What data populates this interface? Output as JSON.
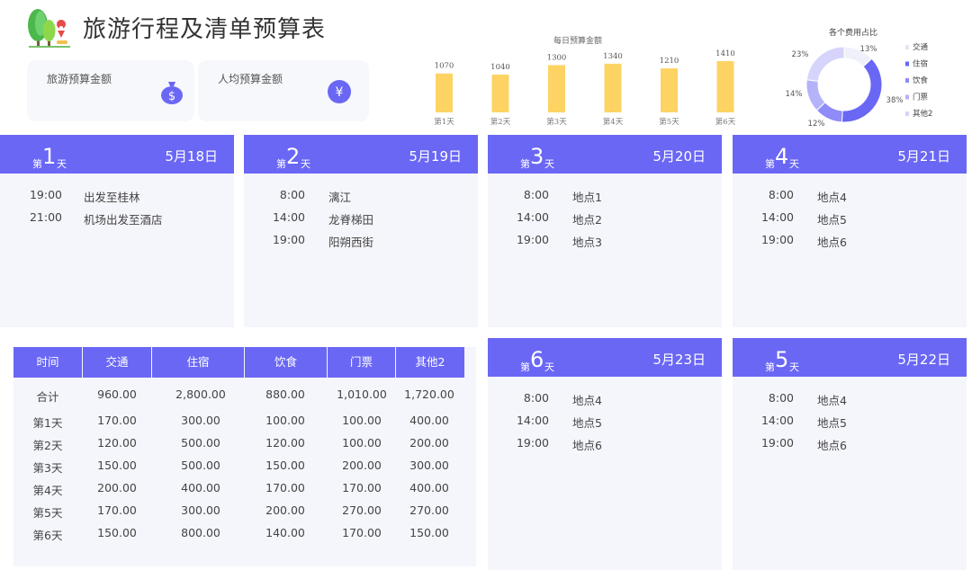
{
  "header": {
    "title": "旅游行程及清单预算表"
  },
  "budget_cards": [
    {
      "label": "旅游预算金额",
      "value": "",
      "icon": "money-bag-icon"
    },
    {
      "label": "人均预算金额",
      "value": "",
      "icon": "yen-icon"
    }
  ],
  "colors": {
    "accent": "#6a67f5",
    "bar": "#fdd364",
    "card_bg": "#f5f6fc"
  },
  "chart_data": [
    {
      "type": "bar",
      "title": "每日预算金额",
      "categories": [
        "第1天",
        "第2天",
        "第3天",
        "第4天",
        "第5天",
        "第6天"
      ],
      "values": [
        1070,
        1040,
        1300,
        1340,
        1210,
        1410
      ]
    },
    {
      "type": "pie",
      "title": "各个费用占比",
      "labels": [
        "交通",
        "住宿",
        "饮食",
        "门票",
        "其他2"
      ],
      "values": [
        13,
        38,
        12,
        14,
        23
      ],
      "value_labels": [
        "13%",
        "38%",
        "12%",
        "14%",
        "23%"
      ],
      "colors": [
        "#f0f0fa",
        "#6a67f5",
        "#8f8bf7",
        "#b4b2f8",
        "#d6d4fb"
      ]
    }
  ],
  "days": [
    {
      "prefix": "第",
      "num": "1",
      "suffix": "天",
      "date": "5月18日",
      "items": [
        {
          "time": "19:00",
          "place": "出发至桂林"
        },
        {
          "time": "21:00",
          "place": "机场出发至酒店"
        }
      ]
    },
    {
      "prefix": "第",
      "num": "2",
      "suffix": "天",
      "date": "5月19日",
      "items": [
        {
          "time": "8:00",
          "place": "漓江"
        },
        {
          "time": "14:00",
          "place": "龙脊梯田"
        },
        {
          "time": "19:00",
          "place": "阳朔西街"
        }
      ]
    },
    {
      "prefix": "第",
      "num": "3",
      "suffix": "天",
      "date": "5月20日",
      "items": [
        {
          "time": "8:00",
          "place": "地点1"
        },
        {
          "time": "14:00",
          "place": "地点2"
        },
        {
          "time": "19:00",
          "place": "地点3"
        }
      ]
    },
    {
      "prefix": "第",
      "num": "4",
      "suffix": "天",
      "date": "5月21日",
      "items": [
        {
          "time": "8:00",
          "place": "地点4"
        },
        {
          "time": "14:00",
          "place": "地点5"
        },
        {
          "time": "19:00",
          "place": "地点6"
        }
      ]
    },
    {
      "prefix": "第",
      "num": "6",
      "suffix": "天",
      "date": "5月23日",
      "items": [
        {
          "time": "8:00",
          "place": "地点4"
        },
        {
          "time": "14:00",
          "place": "地点5"
        },
        {
          "time": "19:00",
          "place": "地点6"
        }
      ]
    },
    {
      "prefix": "第",
      "num": "5",
      "suffix": "天",
      "date": "5月22日",
      "items": [
        {
          "time": "8:00",
          "place": "地点4"
        },
        {
          "time": "14:00",
          "place": "地点5"
        },
        {
          "time": "19:00",
          "place": "地点6"
        }
      ]
    }
  ],
  "table": {
    "headers": [
      "时间",
      "交通",
      "住宿",
      "饮食",
      "门票",
      "其他2"
    ],
    "rows": [
      [
        "合计",
        "960.00",
        "2,800.00",
        "880.00",
        "1,010.00",
        "1,720.00"
      ],
      [
        "第1天",
        "170.00",
        "300.00",
        "100.00",
        "100.00",
        "400.00"
      ],
      [
        "第2天",
        "120.00",
        "500.00",
        "120.00",
        "100.00",
        "200.00"
      ],
      [
        "第3天",
        "150.00",
        "500.00",
        "150.00",
        "200.00",
        "300.00"
      ],
      [
        "第4天",
        "200.00",
        "400.00",
        "170.00",
        "170.00",
        "400.00"
      ],
      [
        "第5天",
        "170.00",
        "300.00",
        "200.00",
        "270.00",
        "270.00"
      ],
      [
        "第6天",
        "150.00",
        "800.00",
        "140.00",
        "170.00",
        "150.00"
      ]
    ]
  }
}
